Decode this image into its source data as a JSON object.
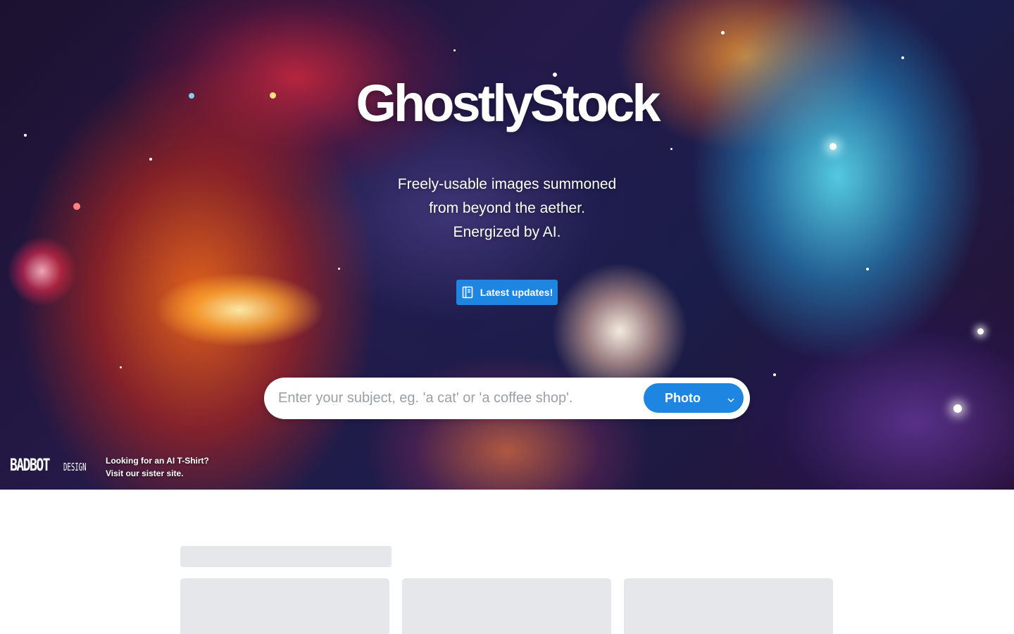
{
  "hero": {
    "site_title": "GhostlyStock",
    "tagline_lines": [
      "Freely-usable images summoned",
      "from beyond the aether.",
      "Energized by AI."
    ],
    "updates_button_label": "Latest updates!",
    "updates_button_icon": "book-icon"
  },
  "search": {
    "placeholder": "Enter your subject, eg. 'a cat' or 'a coffee shop'.",
    "value": "",
    "type_selected": "Photo",
    "type_icon": "chevron-down-icon"
  },
  "sister_site": {
    "logo_main": "BADBOT",
    "logo_sub": "DESIGN",
    "line1": "Looking for an AI T-Shirt?",
    "line2": "Visit our sister site."
  },
  "colors": {
    "accent": "#1e86e0",
    "skeleton": "#e5e7ea",
    "text_on_hero": "#ffffff"
  }
}
